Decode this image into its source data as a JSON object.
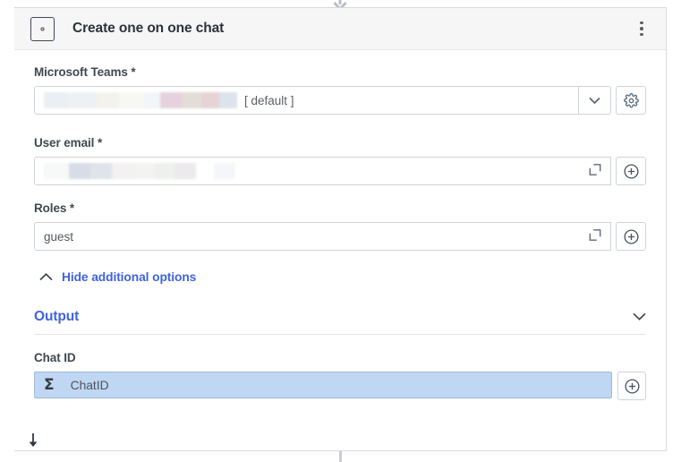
{
  "node": {
    "icon": "gear-in-box-icon",
    "title": "Create one on one chat",
    "menu_icon": "kebab-menu-icon"
  },
  "fields": [
    {
      "key": "teams",
      "label": "Microsoft Teams *",
      "value": "",
      "suffix_text": "[ default ]",
      "control_icon": "chevron-down-icon",
      "action_icon": "gear-icon",
      "redacted": true
    },
    {
      "key": "user_email",
      "label": "User email *",
      "value": "",
      "expand_icon": "expand-icon",
      "action_icon": "plus-circle-icon",
      "redacted": true
    },
    {
      "key": "roles",
      "label": "Roles *",
      "value": "guest",
      "expand_icon": "expand-icon",
      "action_icon": "plus-circle-icon",
      "redacted": false
    }
  ],
  "additional_options": {
    "label": "Hide additional options",
    "icon": "chevron-up-icon",
    "color": "#3f63e0"
  },
  "output": {
    "title": "Output",
    "collapse_icon": "chevron-down-icon",
    "fields": [
      {
        "key": "chat_id",
        "label": "Chat ID",
        "value": "ChatID",
        "value_icon": "sigma-icon",
        "action_icon": "plus-circle-icon",
        "highlight_color": "#bfd7f3"
      }
    ]
  },
  "colors": {
    "link": "#3f63e0",
    "selection_bar": "#4d5862",
    "header_bg": "#f6f6f6",
    "field_border": "#cfd4d9",
    "icon_stroke": "#5b6b7d"
  },
  "connectors": {
    "top_arrow": "flow-arrow-down-icon",
    "bottom_line": "flow-connector-line",
    "drag_arrow": "drag-down-arrow-icon"
  }
}
